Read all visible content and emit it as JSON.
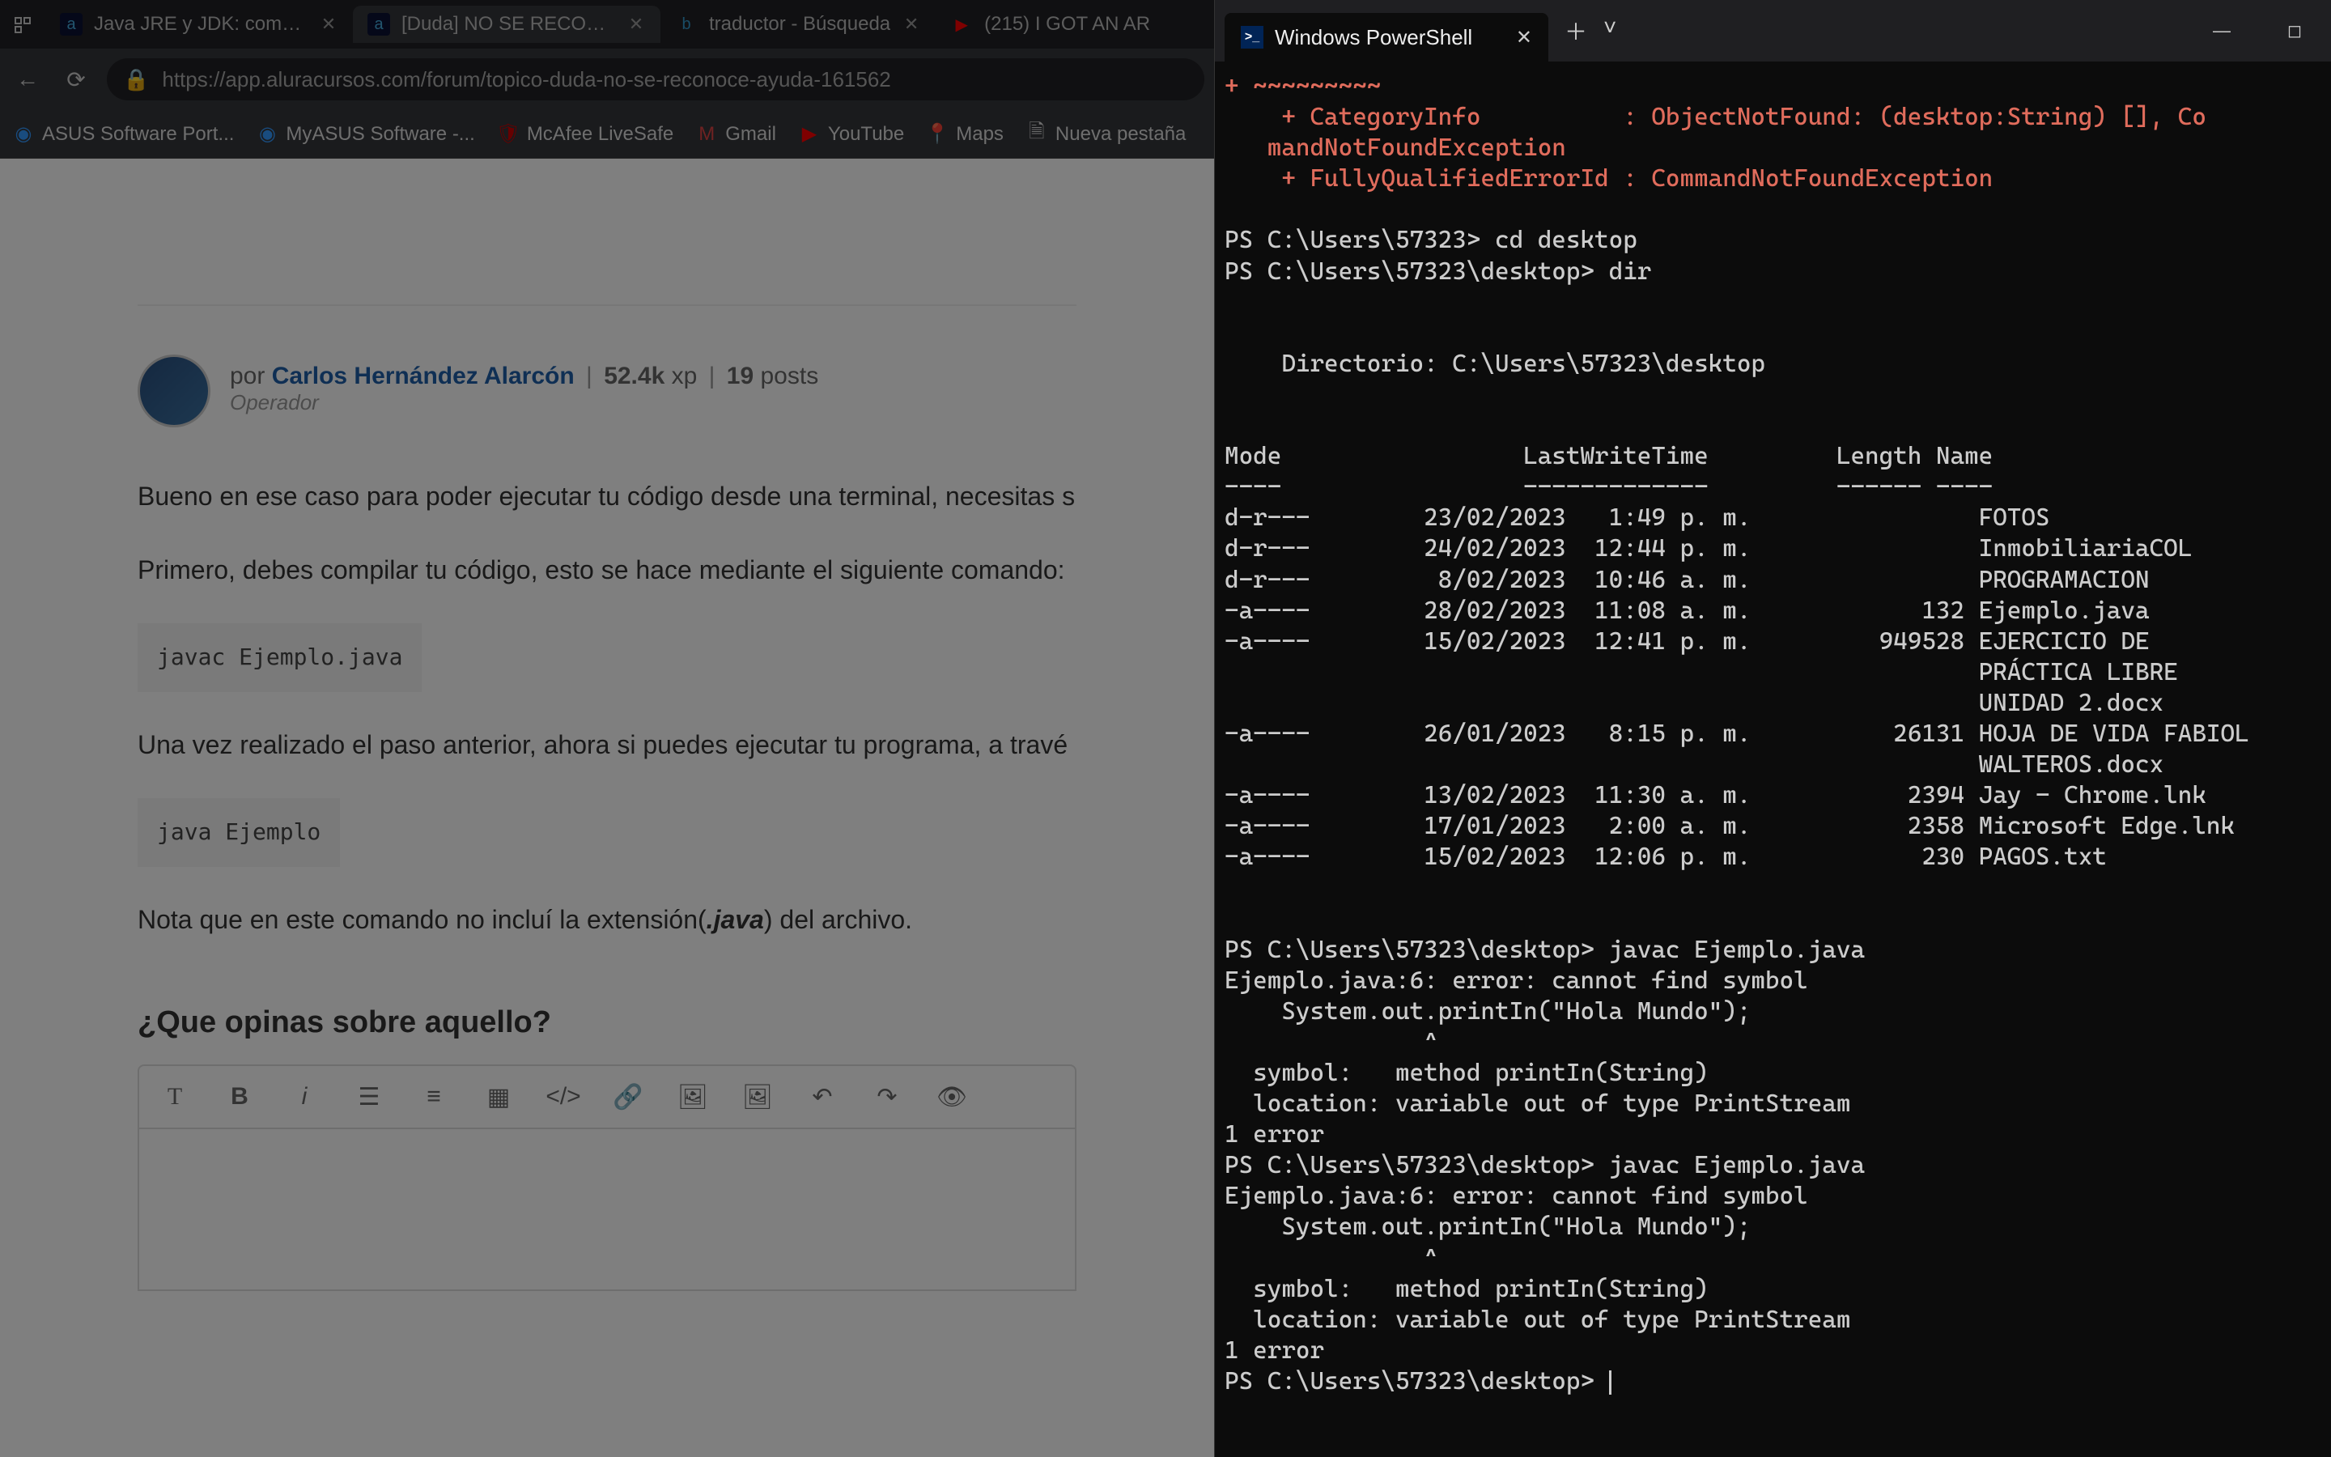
{
  "browser": {
    "tabs": [
      {
        "favicon": "a",
        "title": "Java JRE y JDK: compile y"
      },
      {
        "favicon": "a",
        "title": "[Duda] NO SE RECONOC"
      },
      {
        "favicon": "🔍",
        "title": "traductor - Búsqueda"
      },
      {
        "favicon": "▶",
        "title": "(215) I GOT AN AR"
      }
    ],
    "url": "https://app.aluracursos.com/forum/topico-duda-no-se-reconoce-ayuda-161562",
    "bookmarks": [
      {
        "icon": "🔵",
        "label": "ASUS Software Port..."
      },
      {
        "icon": "🔵",
        "label": "MyASUS Software -..."
      },
      {
        "icon": "🛡",
        "label": "McAfee LiveSafe"
      },
      {
        "icon": "M",
        "label": "Gmail"
      },
      {
        "icon": "▶",
        "label": "YouTube"
      },
      {
        "icon": "📍",
        "label": "Maps"
      },
      {
        "icon": "📄",
        "label": "Nueva pestaña"
      }
    ]
  },
  "forum": {
    "author_prefix": "por ",
    "author_name": "Carlos Hernández Alarcón",
    "xp": "52.4k",
    "xp_label": "xp",
    "posts": "19",
    "posts_label": "posts",
    "role": "Operador",
    "p1": "Bueno en ese caso para poder ejecutar tu código desde una terminal, necesitas s",
    "p2": "Primero, debes compilar tu código, esto se hace mediante el siguiente comando:",
    "code1": "javac Ejemplo.java",
    "p3": "Una vez realizado el paso anterior, ahora si puedes ejecutar tu programa, a travé",
    "code2": "java Ejemplo",
    "p4_pre": "Nota que en este comando no incluí la extensión(",
    "p4_ext": ".java",
    "p4_post": ") del archivo.",
    "opinion_heading": "¿Que opinas sobre aquello?"
  },
  "terminal": {
    "tab_title": "Windows PowerShell",
    "error_lines": {
      "l0": "+ ~~~~~~~~~",
      "l1a": "    + CategoryInfo",
      "l1b": ": ObjectNotFound: (desktop:String) [], Co",
      "l2": "   mandNotFoundException",
      "l3": "    + FullyQualifiedErrorId : CommandNotFoundException"
    },
    "ps1": "PS C:\\Users\\57323> ",
    "cmd1": "cd desktop",
    "ps2": "PS C:\\Users\\57323\\desktop> ",
    "cmd2": "dir",
    "dir_header": "    Directorio: C:\\Users\\57323\\desktop",
    "cols": "Mode                 LastWriteTime         Length Name",
    "colsep": "----                 -------------         ------ ----",
    "rows": [
      "d-r---        23/02/2023   1:49 p. m.                FOTOS",
      "d-r---        24/02/2023  12:44 p. m.                InmobiliariaCOL",
      "d-r---         8/02/2023  10:46 a. m.                PROGRAMACION",
      "-a----        28/02/2023  11:08 a. m.            132 Ejemplo.java",
      "-a----        15/02/2023  12:41 p. m.         949528 EJERCICIO DE",
      "                                                     PRÁCTICA LIBRE",
      "                                                     UNIDAD 2.docx",
      "-a----        26/01/2023   8:15 p. m.          26131 HOJA DE VIDA FABIOL",
      "                                                     WALTEROS.docx",
      "-a----        13/02/2023  11:30 a. m.           2394 Jay - Chrome.lnk",
      "-a----        17/01/2023   2:00 a. m.           2358 Microsoft Edge.lnk",
      "-a----        15/02/2023  12:06 p. m.            230 PAGOS.txt"
    ],
    "cmd3": "javac Ejemplo.java",
    "err3": [
      "Ejemplo.java:6: error: cannot find symbol",
      "    System.out.printIn(\"Hola Mundo\");",
      "              ^",
      "  symbol:   method printIn(String)",
      "  location: variable out of type PrintStream",
      "1 error"
    ],
    "cmd4": "javac Ejemplo.java",
    "err4": [
      "Ejemplo.java:6: error: cannot find symbol",
      "    System.out.printIn(\"Hola Mundo\");",
      "              ^",
      "  symbol:   method printIn(String)",
      "  location: variable out of type PrintStream",
      "1 error"
    ]
  }
}
